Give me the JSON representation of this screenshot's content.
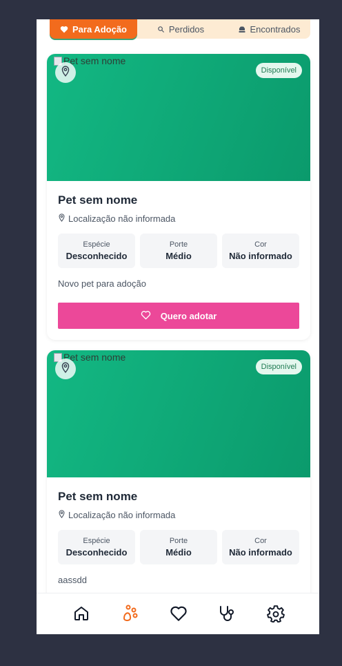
{
  "tabs": [
    {
      "label": "Para Adoção",
      "icon": "heart-icon",
      "active": true
    },
    {
      "label": "Perdidos",
      "icon": "search-icon",
      "active": false
    },
    {
      "label": "Encontrados",
      "icon": "dog-icon",
      "active": false
    }
  ],
  "cards": [
    {
      "image_alt": "Pet sem nome",
      "status": "Disponível",
      "name": "Pet sem nome",
      "location": "Localização não informada",
      "stats": [
        {
          "label": "Espécie",
          "value": "Desconhecido"
        },
        {
          "label": "Porte",
          "value": "Médio"
        },
        {
          "label": "Cor",
          "value": "Não informado"
        }
      ],
      "description": "Novo pet para adoção",
      "button_label": "Quero adotar"
    },
    {
      "image_alt": "Pet sem nome",
      "status": "Disponível",
      "name": "Pet sem nome",
      "location": "Localização não informada",
      "stats": [
        {
          "label": "Espécie",
          "value": "Desconhecido"
        },
        {
          "label": "Porte",
          "value": "Médio"
        },
        {
          "label": "Cor",
          "value": "Não informado"
        }
      ],
      "description": "aassdd"
    }
  ],
  "bottom_nav": [
    {
      "icon": "home-icon",
      "active": false
    },
    {
      "icon": "paw-icon",
      "active": true
    },
    {
      "icon": "heart-icon",
      "active": false
    },
    {
      "icon": "stethoscope-icon",
      "active": false
    },
    {
      "icon": "settings-icon",
      "active": false
    }
  ],
  "colors": {
    "accent": "#f26b1d",
    "adopt_button": "#ec4899",
    "card_image": "#10a776",
    "badge_bg": "#e4f7ee",
    "background": "#2d3142"
  }
}
